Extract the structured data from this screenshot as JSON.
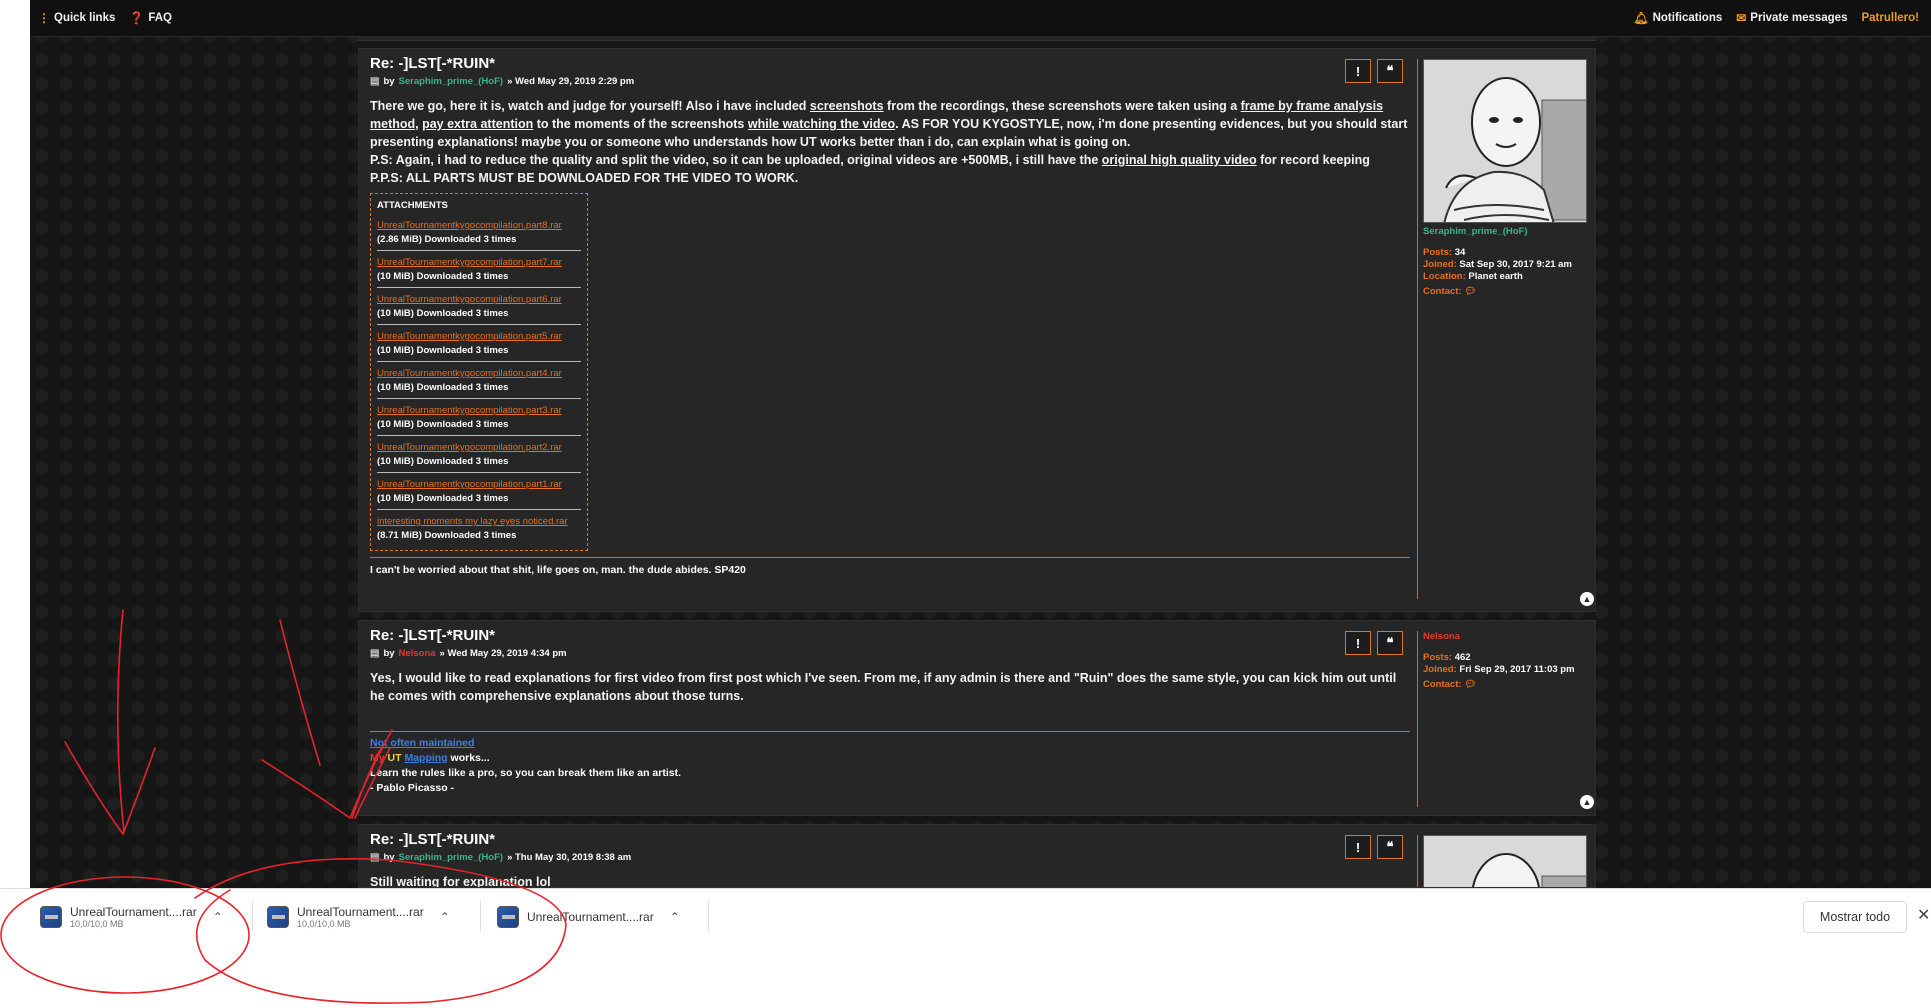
{
  "navbar": {
    "quick_links": "Quick links",
    "faq": "FAQ",
    "notifications": "Notifications",
    "private_messages": "Private messages",
    "username": "Patrullero!"
  },
  "posts": [
    {
      "title": "Re: -]LST[-*RUIN*",
      "by": "by",
      "author": "Seraphim_prime_(HoF)",
      "date": "» Wed May 29, 2019 2:29 pm",
      "content": {
        "l1a": "There we go, here it is, watch and judge for yourself! Also i have included ",
        "l1_screenshots": "screenshots",
        "l1b": " from the recordings, these screenshots were taken using a ",
        "l1_frame": "frame by frame analysis method",
        "l1c": ", ",
        "l1_pay": "pay extra attention",
        "l1d": " to the moments of the screenshots ",
        "l1_while": "while watching the video",
        "l1e": ". AS FOR YOU KYGOSTYLE, now, i'm done presenting evidences, but you should start presenting explanations! maybe you or someone who understands how UT works better than i do, can explain what is going on.",
        "l2a": "P.S: Again, i had to reduce the quality and split the video, so it can be uploaded, original videos are +500MB, i still have the ",
        "l2_orig": "original high quality video",
        "l2b": " for record keeping",
        "l3": "P.P.S: ALL PARTS MUST BE DOWNLOADED FOR THE VIDEO TO WORK."
      },
      "attachments_heading": "ATTACHMENTS",
      "attachments": [
        {
          "name": "UnrealTournamentkygocompilation.part8.rar",
          "meta": "(2.86 MiB) Downloaded 3 times"
        },
        {
          "name": "UnrealTournamentkygocompilation.part7.rar",
          "meta": "(10 MiB) Downloaded 3 times"
        },
        {
          "name": "UnrealTournamentkygocompilation.part6.rar",
          "meta": "(10 MiB) Downloaded 3 times"
        },
        {
          "name": "UnrealTournamentkygocompilation.part5.rar",
          "meta": "(10 MiB) Downloaded 3 times"
        },
        {
          "name": "UnrealTournamentkygocompilation.part4.rar",
          "meta": "(10 MiB) Downloaded 3 times"
        },
        {
          "name": "UnrealTournamentkygocompilation.part3.rar",
          "meta": "(10 MiB) Downloaded 3 times"
        },
        {
          "name": "UnrealTournamentkygocompilation.part2.rar",
          "meta": "(10 MiB) Downloaded 3 times"
        },
        {
          "name": "UnrealTournamentkygocompilation.part1.rar",
          "meta": "(10 MiB) Downloaded 3 times"
        },
        {
          "name": "interesting moments my lazy eyes noticed.rar",
          "meta": "(8.71 MiB) Downloaded 3 times"
        }
      ],
      "signature": "I can't be worried about that shit, life goes on, man. the dude abides. SP420",
      "profile": {
        "name": "Seraphim_prime_(HoF)",
        "posts_label": "Posts:",
        "posts": "34",
        "joined_label": "Joined:",
        "joined": "Sat Sep 30, 2017 9:21 am",
        "location_label": "Location:",
        "location": "Planet earth",
        "contact_label": "Contact:"
      }
    },
    {
      "title": "Re: -]LST[-*RUIN*",
      "by": "by",
      "author": "Nelsona",
      "date": "» Wed May 29, 2019 4:34 pm",
      "content": "Yes, I would like to read explanations for first video from first post which I've seen. From me, if any admin is there and \"Ruin\" does the same style, you can kick him out until he comes with comprehensive explanations about those turns.",
      "sig": {
        "not_often": "Not often maintained",
        "my": "My",
        "ut": "UT",
        "mapping": "Mapping",
        "works": " works...",
        "quote": "Learn the rules like a pro, so you can break them like an artist.",
        "author": "- Pablo Picasso -"
      },
      "profile": {
        "name": "Nelsona",
        "posts_label": "Posts:",
        "posts": "462",
        "joined_label": "Joined:",
        "joined": "Fri Sep 29, 2017 11:03 pm",
        "contact_label": "Contact:"
      }
    },
    {
      "title": "Re: -]LST[-*RUIN*",
      "by": "by",
      "author": "Seraphim_prime_(HoF)",
      "date": "» Thu May 30, 2019 8:38 am",
      "content": "Still waiting for explanation lol"
    }
  ],
  "downloads": [
    {
      "name": "UnrealTournament....rar",
      "size": "10,0/10,0 MB"
    },
    {
      "name": "UnrealTournament....rar",
      "size": "10,0/10,0 MB"
    },
    {
      "name": "UnrealTournament....rar",
      "size": ""
    }
  ],
  "show_all": "Mostrar todo",
  "colors": {
    "accent": "#e86f1c",
    "green": "#3bb58a",
    "red": "#e23a2a",
    "annotation": "#e8222a"
  }
}
